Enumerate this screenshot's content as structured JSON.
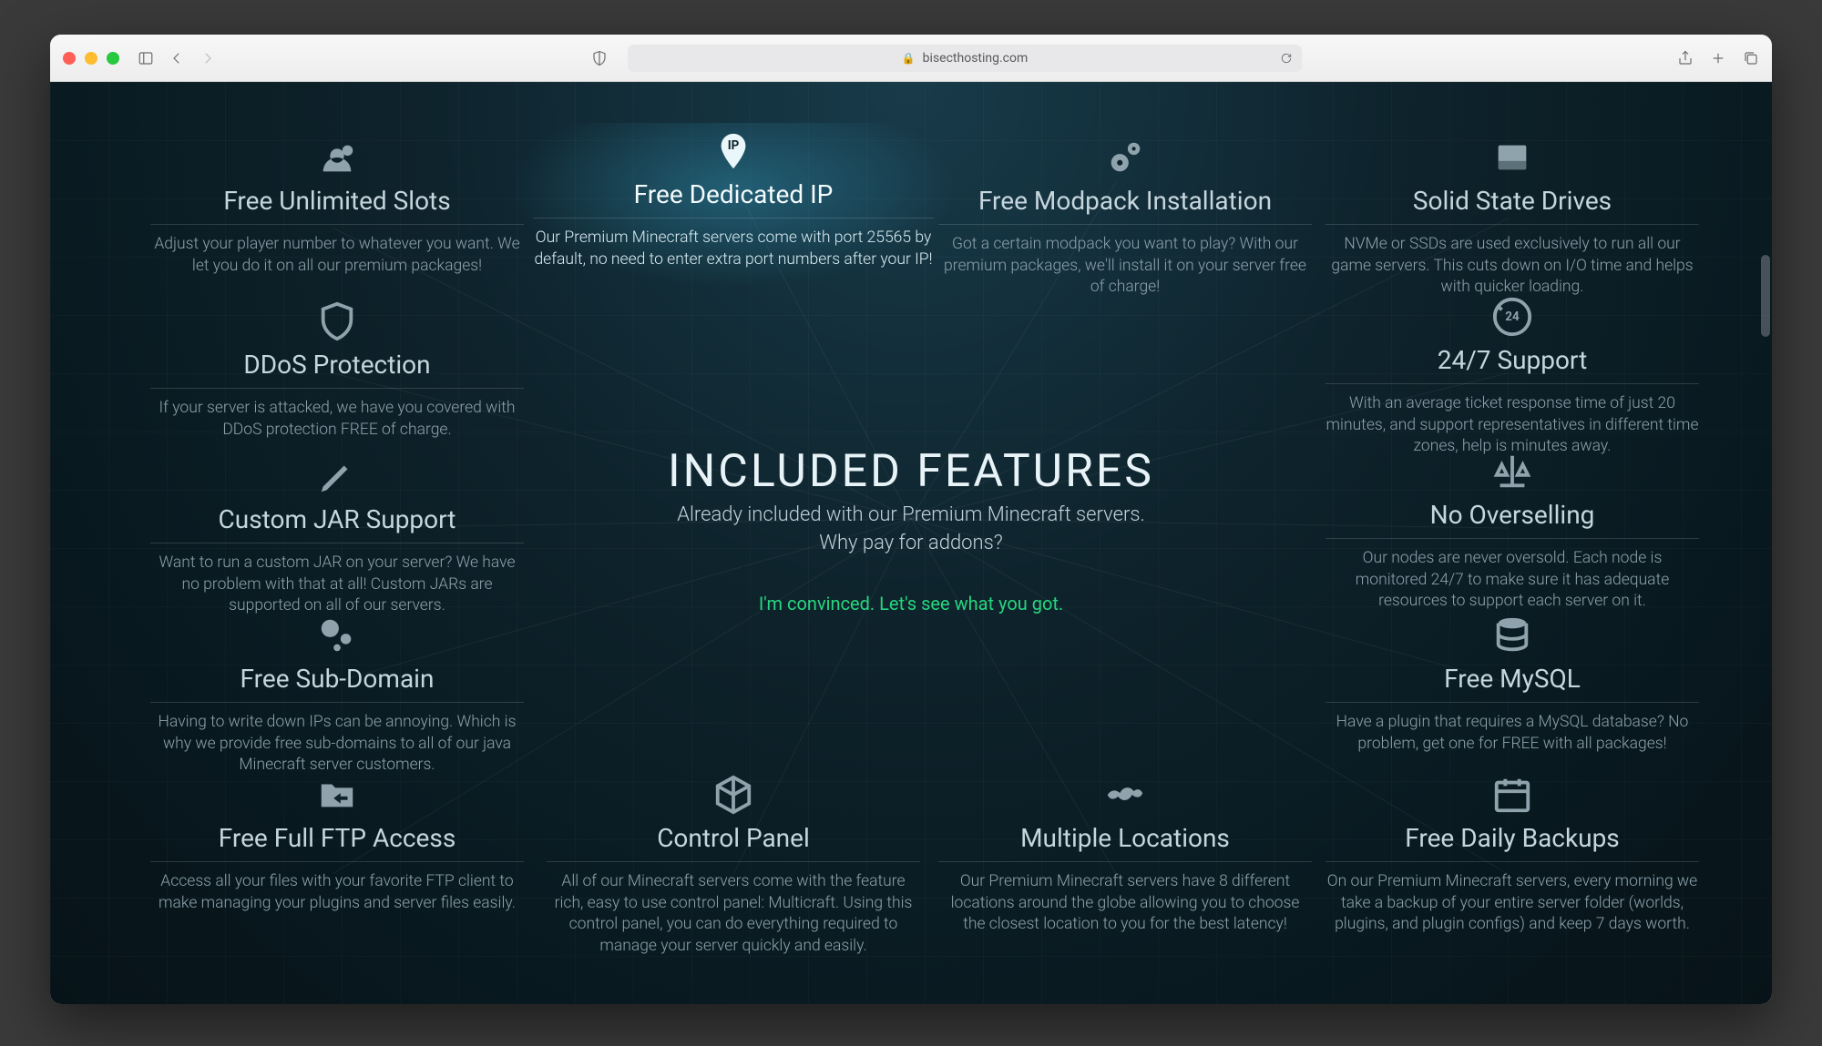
{
  "browser": {
    "domain": "bisecthosting.com"
  },
  "center": {
    "title": "INCLUDED FEATURES",
    "sub1": "Already included with our Premium Minecraft servers.",
    "sub2": "Why pay for addons?",
    "cta": "I'm convinced. Let's see what you got."
  },
  "features": {
    "unlimited_slots": {
      "title": "Free Unlimited Slots",
      "desc": "Adjust your player number to whatever you want. We let you do it on all our premium packages!"
    },
    "dedicated_ip": {
      "title": "Free Dedicated IP",
      "desc": "Our Premium Minecraft servers come with port 25565 by default, no need to enter extra port numbers after your IP!"
    },
    "modpack": {
      "title": "Free Modpack Installation",
      "desc": "Got a certain modpack you want to play? With our premium packages, we'll install it on your server free of charge!"
    },
    "ssd": {
      "title": "Solid State Drives",
      "desc": "NVMe or SSDs are used exclusively to run all our game servers. This cuts down on I/O time and helps with quicker loading."
    },
    "ddos": {
      "title": "DDoS Protection",
      "desc": "If your server is attacked, we have you covered with DDoS protection FREE of charge."
    },
    "support": {
      "title": "24/7 Support",
      "desc": "With an average ticket response time of just 20 minutes, and support representatives in different time zones, help is minutes away."
    },
    "jar": {
      "title": "Custom JAR Support",
      "desc": "Want to run a custom JAR on your server? We have no problem with that at all! Custom JARs are supported on all of our servers."
    },
    "oversell": {
      "title": "No Overselling",
      "desc": "Our nodes are never oversold. Each node is monitored 24/7 to make sure it has adequate resources to support each server on it."
    },
    "subdomain": {
      "title": "Free Sub-Domain",
      "desc": "Having to write down IPs can be annoying. Which is why we provide free sub-domains to all of our java Minecraft server customers."
    },
    "mysql": {
      "title": "Free MySQL",
      "desc": "Have a plugin that requires a MySQL database? No problem, get one for FREE with all packages!"
    },
    "ftp": {
      "title": "Free Full FTP Access",
      "desc": "Access all your files with your favorite FTP client to make managing your plugins and server files easily."
    },
    "cpanel": {
      "title": "Control Panel",
      "desc": "All of our Minecraft servers come with the feature rich, easy to use control panel: Multicraft. Using this control panel, you can do everything required to manage your server quickly and easily."
    },
    "locations": {
      "title": "Multiple Locations",
      "desc": "Our Premium Minecraft servers have 8 different locations around the globe allowing you to choose the closest location to you for the best latency!"
    },
    "backups": {
      "title": "Free Daily Backups",
      "desc": "On our Premium Minecraft servers, every morning we take a backup of your entire server folder (worlds, plugins, and plugin configs) and keep 7 days worth."
    }
  }
}
